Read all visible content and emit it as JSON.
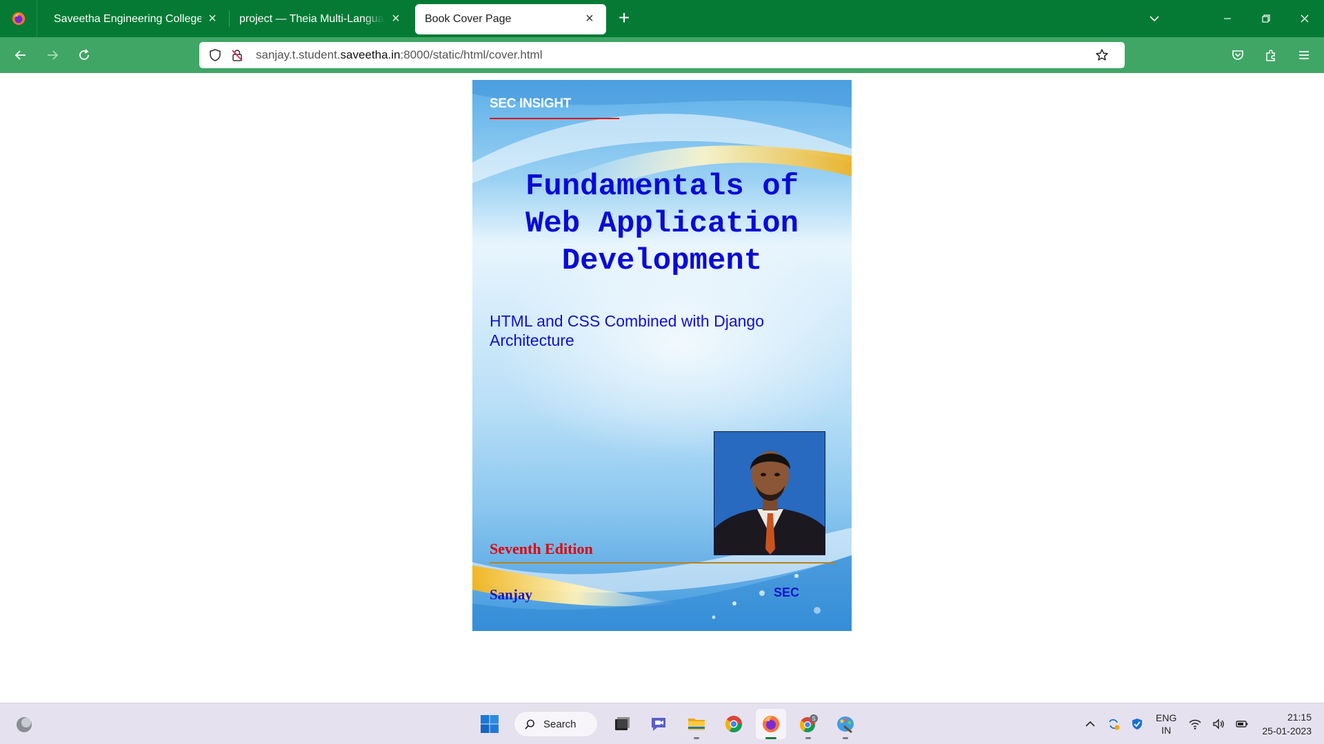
{
  "browser": {
    "tabs": [
      {
        "title": "Saveetha Engineering College",
        "active": false
      },
      {
        "title": "project — Theia Multi-Language Explorer",
        "active": false
      },
      {
        "title": "Book Cover Page",
        "active": true
      }
    ],
    "url": {
      "prefix": "sanjay.t.student.",
      "domain": "saveetha.in",
      "suffix": ":8000/static/html/cover.html"
    },
    "colors": {
      "tabstrip": "#047a35",
      "navbar": "#40a665"
    }
  },
  "cover": {
    "brand": "SEC INSIGHT",
    "title_lines": [
      "Fundamentals of",
      "Web Application",
      "Development"
    ],
    "subtitle": "HTML and CSS Combined with Django Architecture",
    "edition": "Seventh Edition",
    "author": "Sanjay",
    "publisher": "SEC",
    "colors": {
      "title": "#0a0ad6",
      "edition": "#e10000",
      "brand_underline": "#dd1111"
    }
  },
  "taskbar": {
    "search_label": "Search",
    "language": {
      "line1": "ENG",
      "line2": "IN"
    },
    "clock": {
      "time": "21:15",
      "date": "25-01-2023"
    },
    "chrome_badge": "S"
  }
}
